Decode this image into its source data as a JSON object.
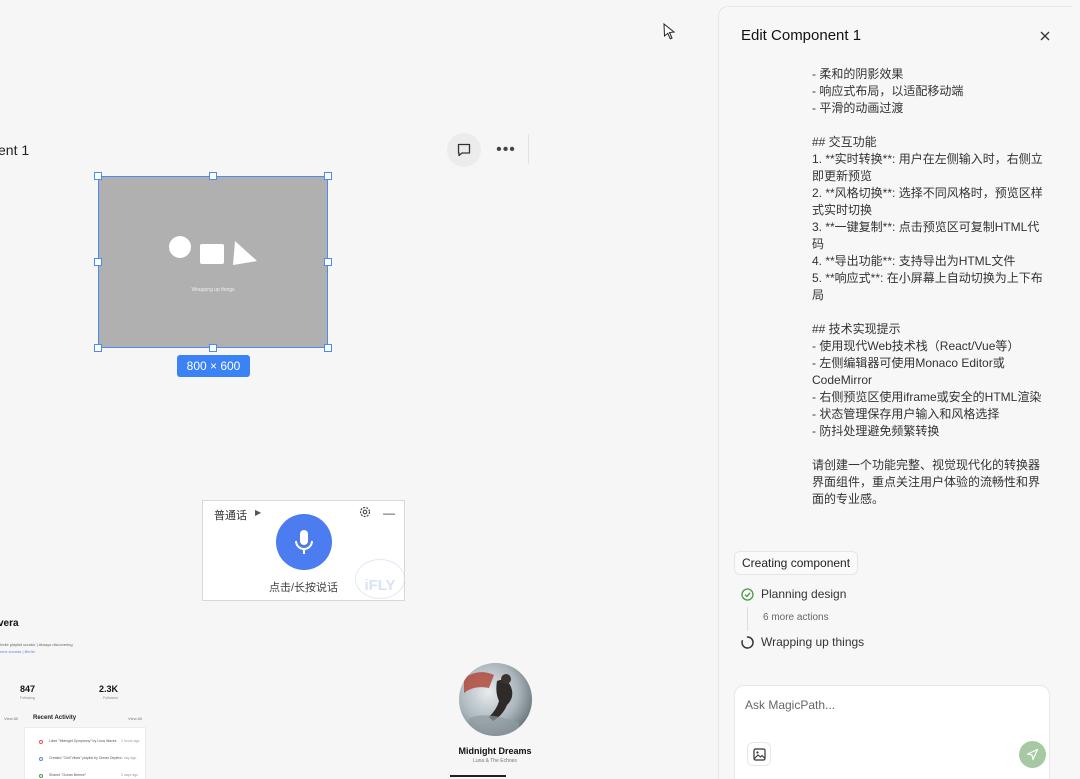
{
  "canvas": {
    "component_label": "ent 1",
    "placeholder_text": "Wrapping up things",
    "dimensions_badge": "800 × 600",
    "voice_widget": {
      "language": "普通话",
      "hint": "点击/长按说话",
      "logo_text": "iFLY"
    },
    "profile": {
      "name": "vera",
      "bio": "Indie playlist curator | Always discovering",
      "bio_link": "new sounds | Berlin",
      "stats": [
        {
          "value": "847",
          "label": "Following"
        },
        {
          "value": "2.3K",
          "label": "Followers"
        }
      ],
      "view_all_left": "View All",
      "recent_activity": "Recent Activity",
      "view_all_right": "View All",
      "activities": [
        {
          "text": "Liked \"Midnight Symphony\" by Luna Waves",
          "time": "2 hours ago"
        },
        {
          "text": "Created \"Chill Vibes\" playlist by Ocean Depths",
          "time": "1 day ago"
        },
        {
          "text": "Shared \"Ocean Breeze\"",
          "time": "3 days ago"
        }
      ]
    },
    "music_card": {
      "title": "Midnight Dreams",
      "artist": "Luna & The Echoes"
    }
  },
  "panel": {
    "title": "Edit Component 1",
    "message_lines": [
      "- 柔和的阴影效果",
      "- 响应式布局，以适配移动端",
      "- 平滑的动画过渡",
      "",
      "## 交互功能",
      "1. **实时转换**: 用户在左侧输入时，右侧立即更新预览",
      "2. **风格切换**: 选择不同风格时，预览区样式实时切换",
      "3. **一键复制**: 点击预览区可复制HTML代码",
      "4. **导出功能**: 支持导出为HTML文件",
      "5. **响应式**: 在小屏幕上自动切换为上下布局",
      "",
      "## 技术实现提示",
      "- 使用现代Web技术栈（React/Vue等）",
      "- 左侧编辑器可使用Monaco Editor或CodeMirror",
      "- 右侧预览区使用iframe或安全的HTML渲染",
      "- 状态管理保存用户输入和风格选择",
      "- 防抖处理避免频繁转换",
      "",
      "请创建一个功能完整、视觉现代化的转换器界面组件，重点关注用户体验的流畅性和界面的专业感。"
    ],
    "creating_label": "Creating component",
    "steps": [
      {
        "label": "Planning design",
        "status": "done"
      },
      {
        "label": "Wrapping up things",
        "status": "loading"
      }
    ],
    "more_actions": "6 more actions",
    "input_placeholder": "Ask MagicPath...",
    "colors": {
      "accent": "#3b82f6",
      "mic": "#4b7cf0",
      "send": "#a6c9a2",
      "done": "#4a9a48"
    }
  }
}
